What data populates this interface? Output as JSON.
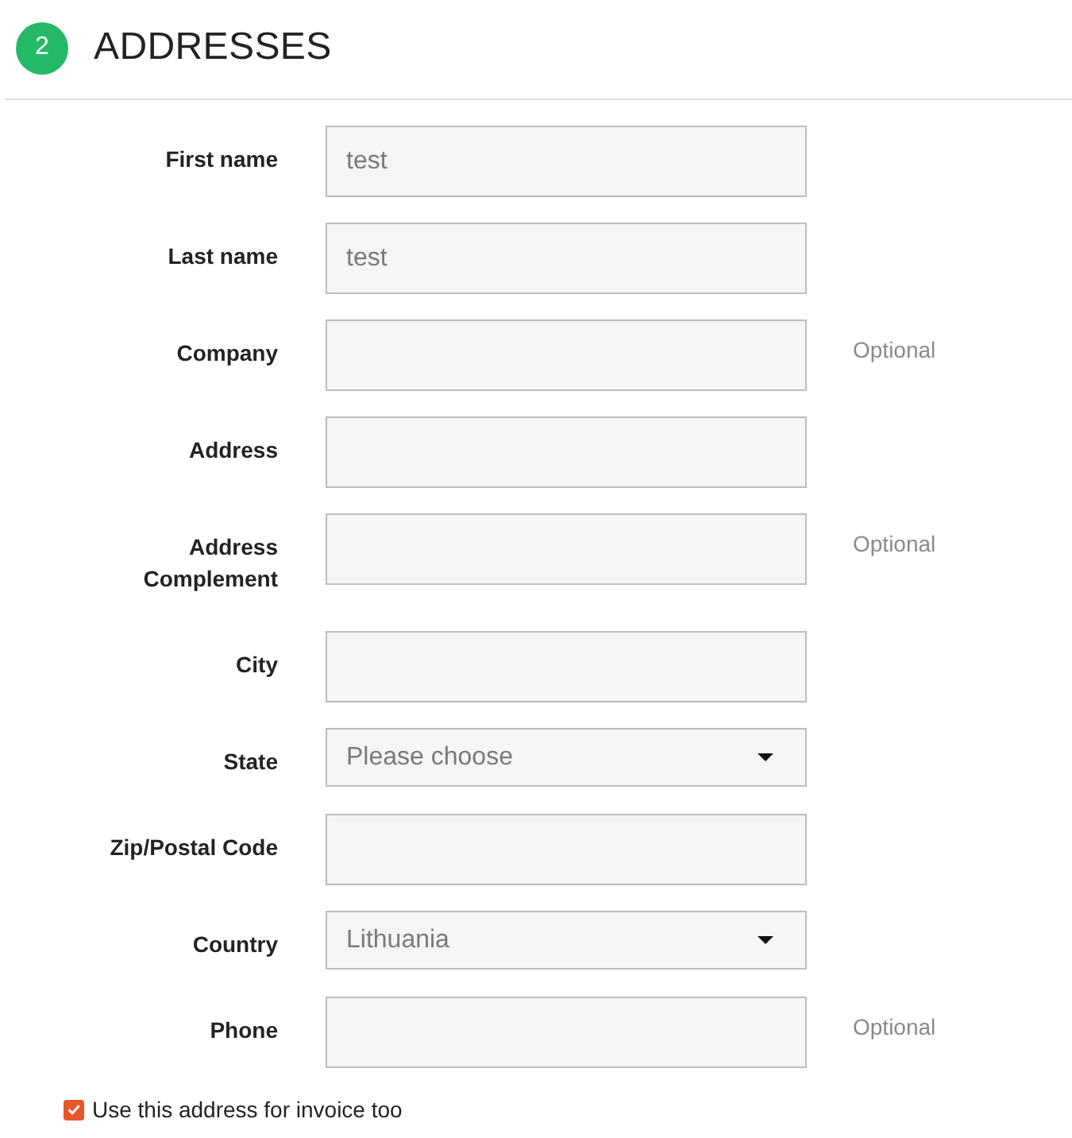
{
  "section": {
    "step": "2",
    "title": "ADDRESSES"
  },
  "fields": [
    {
      "label": "First name",
      "kind": "text",
      "value": "test"
    },
    {
      "label": "Last name",
      "kind": "text",
      "value": "test"
    },
    {
      "label": "Company",
      "kind": "text",
      "note": "Optional"
    },
    {
      "label": "Address",
      "kind": "text"
    },
    {
      "label": "Address Complement",
      "kind": "text",
      "note": "Optional"
    },
    {
      "label": "City",
      "kind": "text"
    },
    {
      "label": "State",
      "kind": "select",
      "value": "Please choose"
    },
    {
      "label": "Zip/Postal Code",
      "kind": "text"
    },
    {
      "label": "Country",
      "kind": "select",
      "value": "Lithuania"
    },
    {
      "label": "Phone",
      "kind": "text",
      "note": "Optional"
    }
  ],
  "invoice_option": {
    "label": "Use this address for invoice too",
    "checked": true
  }
}
